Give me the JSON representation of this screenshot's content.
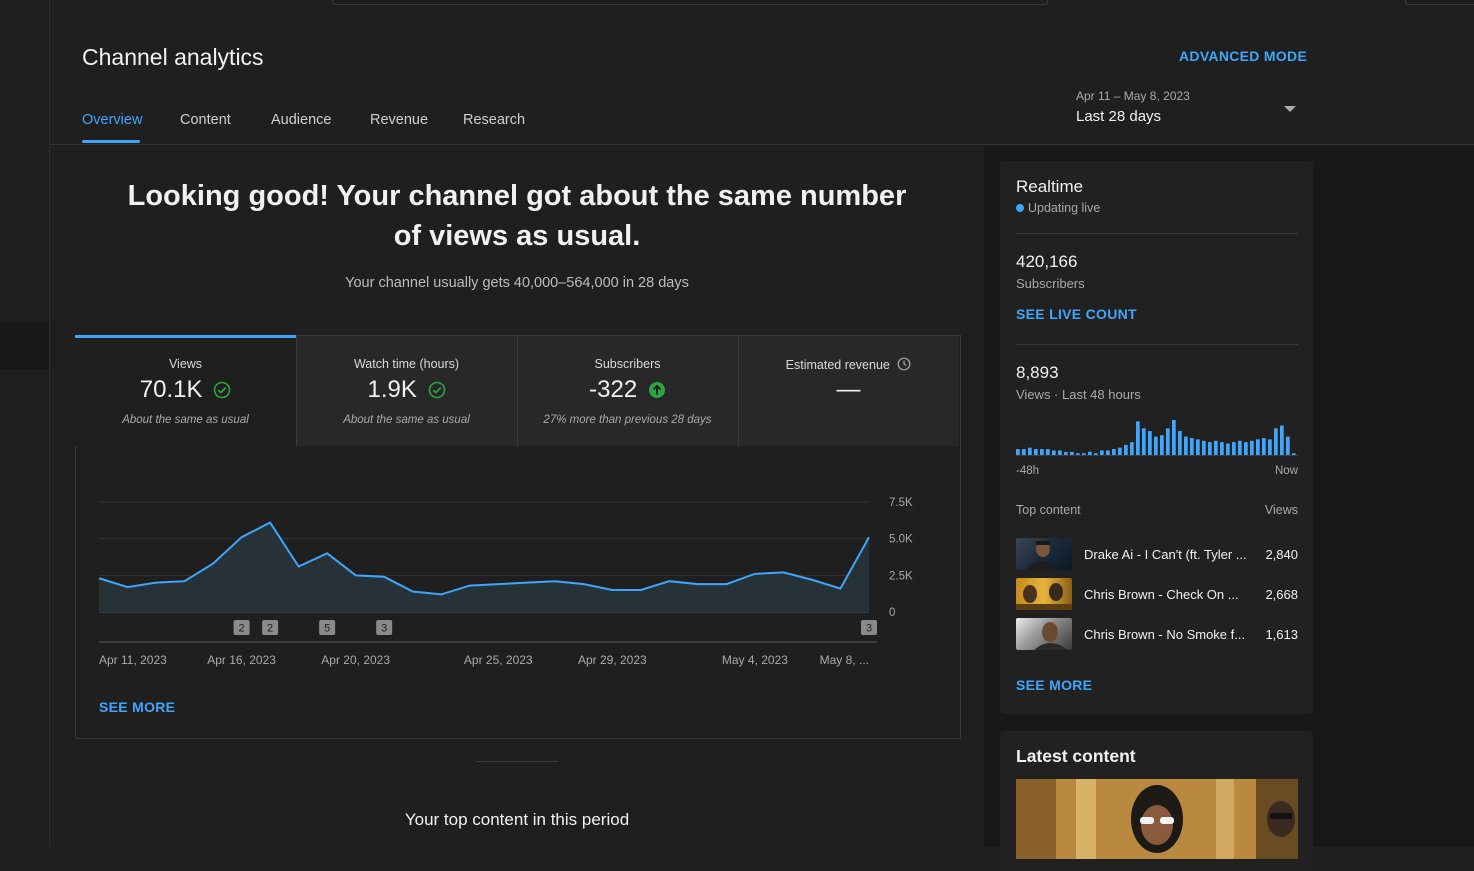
{
  "header": {
    "title": "Channel analytics",
    "advanced_mode": "ADVANCED MODE",
    "tabs": [
      "Overview",
      "Content",
      "Audience",
      "Revenue",
      "Research"
    ],
    "date_range": "Apr 11 – May 8, 2023",
    "date_period": "Last 28 days"
  },
  "summary": {
    "headline": "Looking good! Your channel got about the same number of views as usual.",
    "subline": "Your channel usually gets 40,000–564,000 in 28 days"
  },
  "metrics": [
    {
      "label": "Views",
      "value": "70.1K",
      "note": "About the same as usual",
      "status": "check"
    },
    {
      "label": "Watch time (hours)",
      "value": "1.9K",
      "note": "About the same as usual",
      "status": "check"
    },
    {
      "label": "Subscribers",
      "value": "-322",
      "note": "27% more than previous 28 days",
      "status": "up"
    },
    {
      "label": "Estimated revenue",
      "value": "—",
      "note": "",
      "status": "clock"
    }
  ],
  "chart_data": {
    "type": "area",
    "x": [
      "Apr 11",
      "Apr 12",
      "Apr 13",
      "Apr 14",
      "Apr 15",
      "Apr 16",
      "Apr 17",
      "Apr 18",
      "Apr 19",
      "Apr 20",
      "Apr 21",
      "Apr 22",
      "Apr 23",
      "Apr 24",
      "Apr 25",
      "Apr 26",
      "Apr 27",
      "Apr 28",
      "Apr 29",
      "Apr 30",
      "May 1",
      "May 2",
      "May 3",
      "May 4",
      "May 5",
      "May 6",
      "May 7",
      "May 8"
    ],
    "values": [
      2300,
      1700,
      2000,
      2100,
      3300,
      5100,
      6100,
      3100,
      4000,
      2500,
      2400,
      1400,
      1200,
      1800,
      1900,
      2000,
      2100,
      1900,
      1500,
      1500,
      2100,
      1900,
      1900,
      2600,
      2700,
      2200,
      1600,
      5100
    ],
    "ylim": [
      0,
      7500
    ],
    "yticks": [
      "7.5K",
      "5.0K",
      "2.5K",
      "0"
    ],
    "xtick_labels": [
      "Apr 11, 2023",
      "Apr 16, 2023",
      "Apr 20, 2023",
      "Apr 25, 2023",
      "Apr 29, 2023",
      "May 4, 2023",
      "May 8, ..."
    ],
    "xtick_index": [
      0,
      5,
      9,
      14,
      18,
      23,
      27
    ],
    "markers": [
      {
        "index": 5,
        "label": "2"
      },
      {
        "index": 6,
        "label": "2"
      },
      {
        "index": 8,
        "label": "5"
      },
      {
        "index": 10,
        "label": "3"
      },
      {
        "index": 27,
        "label": "3"
      }
    ],
    "color": "#3ea6ff",
    "fill": "#263238",
    "grid": true
  },
  "chart_see_more": "SEE MORE",
  "top_content_title": "Your top content in this period",
  "realtime": {
    "title": "Realtime",
    "live_label": "Updating live",
    "subscribers_value": "420,166",
    "subscribers_label": "Subscribers",
    "see_live_count": "SEE LIVE COUNT",
    "views_value": "8,893",
    "views_label": "Views · Last 48 hours",
    "bars": [
      5,
      5,
      6,
      5,
      5,
      5,
      4,
      4,
      3,
      3,
      2,
      2,
      3,
      2,
      4,
      4,
      5,
      6,
      8,
      10,
      25,
      20,
      18,
      14,
      15,
      20,
      26,
      18,
      14,
      13,
      12,
      11,
      10,
      11,
      10,
      9,
      10,
      11,
      10,
      11,
      12,
      13,
      12,
      20,
      22,
      14,
      2
    ],
    "bars_color": "#3ea6ff",
    "axis_start": "-48h",
    "axis_end": "Now",
    "top_content_label": "Top content",
    "top_content_views": "Views",
    "top_items": [
      {
        "title": "Drake Ai - I Can't (ft. Tyler ...",
        "views": "2,840"
      },
      {
        "title": "Chris Brown - Check On ...",
        "views": "2,668"
      },
      {
        "title": "Chris Brown - No Smoke f...",
        "views": "1,613"
      }
    ],
    "see_more": "SEE MORE"
  },
  "latest_content": {
    "title": "Latest content"
  }
}
